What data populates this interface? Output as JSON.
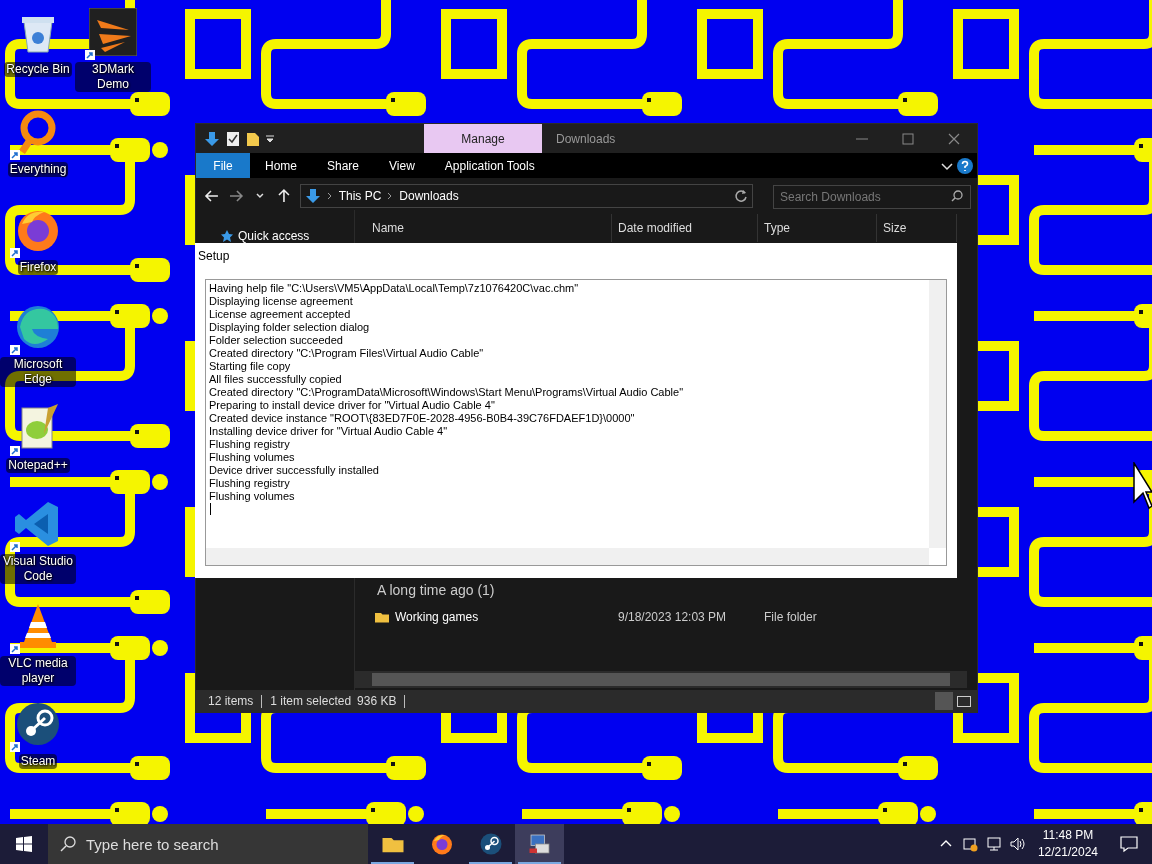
{
  "desktop_icons": [
    {
      "label": "Recycle Bin",
      "kind": "recycle"
    },
    {
      "label": "3DMark Demo",
      "kind": "benchmark"
    },
    {
      "label": "Everything",
      "kind": "search"
    },
    {
      "label": "Firefox",
      "kind": "firefox"
    },
    {
      "label": "Microsoft Edge",
      "kind": "edge"
    },
    {
      "label": "Notepad++",
      "kind": "notepad"
    },
    {
      "label": "Visual Studio Code",
      "kind": "vscode"
    },
    {
      "label": "VLC media player",
      "kind": "vlc"
    },
    {
      "label": "Steam",
      "kind": "steam"
    }
  ],
  "explorer": {
    "context_tab": "Manage",
    "title": "Downloads",
    "ribbon_tabs": [
      {
        "label": "File",
        "kind": "file"
      },
      {
        "label": "Home",
        "kind": "tab"
      },
      {
        "label": "Share",
        "kind": "tab"
      },
      {
        "label": "View",
        "kind": "tab"
      },
      {
        "label": "Application Tools",
        "kind": "tab"
      }
    ],
    "breadcrumb": [
      "This PC",
      "Downloads"
    ],
    "search": {
      "placeholder": "Search Downloads"
    },
    "columns": [
      "Name",
      "Date modified",
      "Type",
      "Size"
    ],
    "nav_items": [
      "Quick access"
    ],
    "group": "A long time ago (1)",
    "rows": [
      {
        "name": "Working games",
        "date": "9/18/2023 12:03 PM",
        "type": "File folder"
      }
    ],
    "status_bar": [
      "12 items",
      "1 item selected",
      "936 KB"
    ]
  },
  "setup": {
    "title": "Setup",
    "log": [
      "Having help file \"C:\\Users\\VM5\\AppData\\Local\\Temp\\7z1076420C\\vac.chm\"",
      "Displaying license agreement",
      "License agreement accepted",
      "Displaying folder selection dialog",
      "Folder selection succeeded",
      "Created directory \"C:\\Program Files\\Virtual Audio Cable\"",
      "Starting file copy",
      "All files successfully copied",
      "Created directory \"C:\\ProgramData\\Microsoft\\Windows\\Start Menu\\Programs\\Virtual Audio Cable\"",
      "Preparing to install device driver for \"Virtual Audio Cable 4\"",
      "Created device instance \"ROOT\\{83ED7F0E-2028-4956-B0B4-39C76FDAEF1D}\\0000\"",
      "Installing device driver for \"Virtual Audio Cable 4\"",
      "Flushing registry",
      "Flushing volumes",
      "Device driver successfully installed",
      "Flushing registry",
      "Flushing volumes"
    ]
  },
  "taskbar": {
    "search": {
      "placeholder": "Type here to search"
    },
    "apps": [
      {
        "kind": "folder",
        "running": true,
        "selected": false
      },
      {
        "kind": "firefox",
        "running": false,
        "selected": false
      },
      {
        "kind": "steam",
        "running": true,
        "selected": false
      },
      {
        "kind": "installer",
        "running": true,
        "selected": true
      }
    ],
    "time": "11:48 PM",
    "date": "12/21/2024"
  }
}
